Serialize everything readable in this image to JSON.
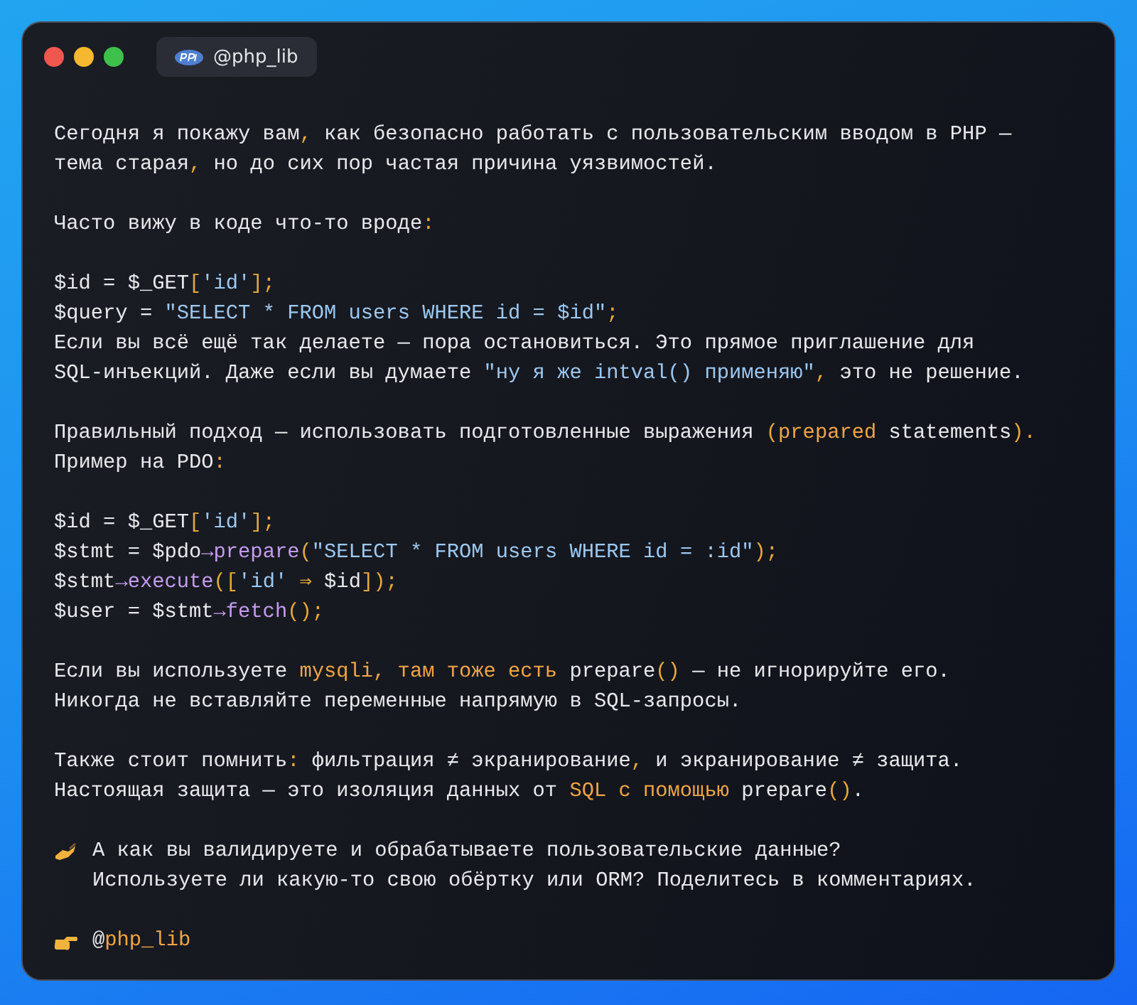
{
  "window": {
    "tab_title": "@php_lib"
  },
  "blocks": [
    {
      "kind": "prose",
      "lines": [
        [
          {
            "kind": "text",
            "text": "Сегодня я покажу вам"
          },
          {
            "kind": "punct",
            "text": ","
          },
          {
            "kind": "text",
            "text": " как безопасно работать с пользовательским вводом в PHP —"
          }
        ],
        [
          {
            "kind": "text",
            "text": "тема старая"
          },
          {
            "kind": "punct",
            "text": ","
          },
          {
            "kind": "text",
            "text": " но до сих пор частая причина уязвимостей."
          }
        ]
      ]
    },
    {
      "kind": "prose",
      "lines": [
        [
          {
            "kind": "text",
            "text": "Часто вижу в коде что-то вроде"
          },
          {
            "kind": "punct",
            "text": ":"
          }
        ]
      ]
    },
    {
      "kind": "code",
      "lines": [
        [
          {
            "kind": "text",
            "text": "$id = $_GET"
          },
          {
            "kind": "punct",
            "text": "["
          },
          {
            "kind": "string",
            "text": "'id'"
          },
          {
            "kind": "punct",
            "text": "];"
          }
        ],
        [
          {
            "kind": "text",
            "text": "$query = "
          },
          {
            "kind": "string",
            "text": "\"SELECT * FROM users WHERE id = $id\""
          },
          {
            "kind": "punct",
            "text": ";"
          }
        ],
        [
          {
            "kind": "text",
            "text": "Если вы всё ещё так делаете — пора остановиться. Это прямое приглашение для"
          }
        ],
        [
          {
            "kind": "text",
            "text": "SQL-инъекций. Даже если вы думаете "
          },
          {
            "kind": "string",
            "text": "\"ну я же intval() применяю\""
          },
          {
            "kind": "punct",
            "text": ","
          },
          {
            "kind": "text",
            "text": " это не решение."
          }
        ]
      ]
    },
    {
      "kind": "prose",
      "lines": [
        [
          {
            "kind": "text",
            "text": "Правильный подход — использовать подготовленные выражения "
          },
          {
            "kind": "punct",
            "text": "("
          },
          {
            "kind": "accent",
            "text": "prepared"
          },
          {
            "kind": "text",
            "text": " statements"
          },
          {
            "kind": "punct",
            "text": ")."
          }
        ],
        [
          {
            "kind": "text",
            "text": "Пример на PDO"
          },
          {
            "kind": "punct",
            "text": ":"
          }
        ]
      ]
    },
    {
      "kind": "code",
      "lines": [
        [
          {
            "kind": "text",
            "text": "$id = $_GET"
          },
          {
            "kind": "punct",
            "text": "["
          },
          {
            "kind": "string",
            "text": "'id'"
          },
          {
            "kind": "punct",
            "text": "];"
          }
        ],
        [
          {
            "kind": "text",
            "text": "$stmt = $pdo"
          },
          {
            "kind": "func",
            "text": "→prepare"
          },
          {
            "kind": "punct",
            "text": "("
          },
          {
            "kind": "string",
            "text": "\"SELECT * FROM users WHERE id = :id\""
          },
          {
            "kind": "punct",
            "text": ");"
          }
        ],
        [
          {
            "kind": "text",
            "text": "$stmt"
          },
          {
            "kind": "func",
            "text": "→execute"
          },
          {
            "kind": "punct",
            "text": "(["
          },
          {
            "kind": "string",
            "text": "'id'"
          },
          {
            "kind": "punct",
            "text": " ⇒ "
          },
          {
            "kind": "text",
            "text": "$id"
          },
          {
            "kind": "punct",
            "text": "]);"
          }
        ],
        [
          {
            "kind": "text",
            "text": "$user = $stmt"
          },
          {
            "kind": "func",
            "text": "→fetch"
          },
          {
            "kind": "punct",
            "text": "();"
          }
        ]
      ]
    },
    {
      "kind": "prose",
      "lines": [
        [
          {
            "kind": "text",
            "text": "Если вы используете "
          },
          {
            "kind": "accent",
            "text": "mysqli, там тоже есть"
          },
          {
            "kind": "text",
            "text": " prepare"
          },
          {
            "kind": "punct",
            "text": "()"
          },
          {
            "kind": "text",
            "text": " — не игнорируйте его."
          }
        ],
        [
          {
            "kind": "text",
            "text": "Никогда не вставляйте переменные напрямую в SQL-запросы."
          }
        ]
      ]
    },
    {
      "kind": "prose",
      "lines": [
        [
          {
            "kind": "text",
            "text": "Также стоит помнить"
          },
          {
            "kind": "punct",
            "text": ":"
          },
          {
            "kind": "text",
            "text": " фильтрация ≠ экранирование"
          },
          {
            "kind": "punct",
            "text": ","
          },
          {
            "kind": "text",
            "text": " и экранирование ≠ защита."
          }
        ],
        [
          {
            "kind": "text",
            "text": "Настоящая защита — это изоляция данных от "
          },
          {
            "kind": "accent",
            "text": "SQL с помощью"
          },
          {
            "kind": "text",
            "text": " prepare"
          },
          {
            "kind": "punct",
            "text": "()"
          },
          {
            "kind": "text",
            "text": "."
          }
        ]
      ]
    },
    {
      "kind": "write-note",
      "lines": [
        [
          {
            "kind": "text",
            "text": "А как вы валидируете и обрабатываете пользовательские данные?"
          }
        ],
        [
          {
            "kind": "text",
            "text": "Используете ли какую-то свою обёртку или ORM? Поделитесь в комментариях."
          }
        ]
      ]
    },
    {
      "kind": "point-note",
      "lines": [
        [
          {
            "kind": "text",
            "text": "@"
          },
          {
            "kind": "accent",
            "text": "php_lib"
          }
        ]
      ]
    }
  ]
}
